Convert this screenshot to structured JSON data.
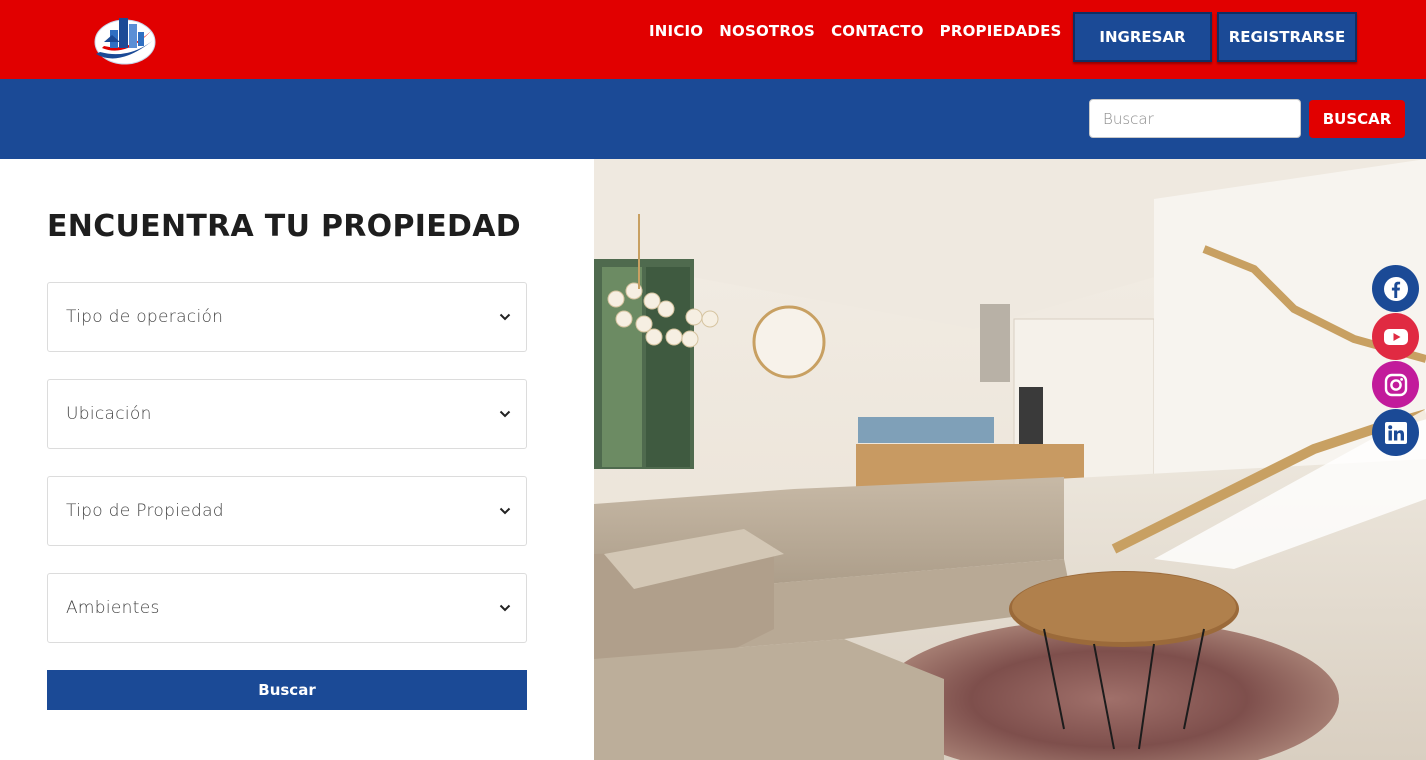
{
  "header": {
    "nav": [
      "INICIO",
      "NOSOTROS",
      "CONTACTO",
      "PROPIEDADES"
    ],
    "login_label": "INGRESAR",
    "register_label": "REGISTRARSE"
  },
  "search": {
    "placeholder": "Buscar",
    "button_label": "BUSCAR"
  },
  "finder": {
    "title": "ENCUENTRA TU PROPIEDAD",
    "selects": [
      "Tipo de operación",
      "Ubicación",
      "Tipo de Propiedad",
      "Ambientes"
    ],
    "button_label": "Buscar"
  },
  "social": [
    "facebook-icon",
    "youtube-icon",
    "instagram-icon",
    "linkedin-icon"
  ],
  "colors": {
    "red": "#e10000",
    "blue": "#1b4a96",
    "youtube": "#e02a42",
    "instagram": "#c21b9b"
  }
}
